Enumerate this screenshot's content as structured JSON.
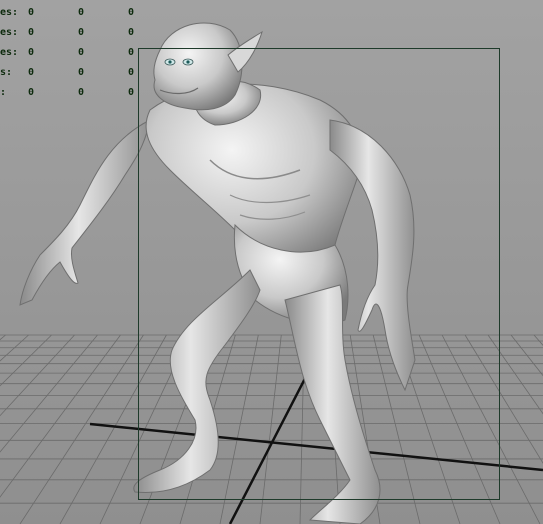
{
  "hud": {
    "rows": [
      {
        "label": "es:",
        "v1": "0",
        "v2": "0",
        "v3": "0"
      },
      {
        "label": "es:",
        "v1": "0",
        "v2": "0",
        "v3": "0"
      },
      {
        "label": "es:",
        "v1": "0",
        "v2": "0",
        "v3": "0"
      },
      {
        "label": "s:",
        "v1": "0",
        "v2": "0",
        "v3": "0"
      },
      {
        "label": ":",
        "v1": "0",
        "v2": "0",
        "v3": "0"
      }
    ]
  },
  "viewport": {
    "background_color": "#9a9a9a",
    "grid_color": "#6a6a6a",
    "axis_color": "#111111",
    "resolution_gate_color": "#1e3a2a",
    "model_color": "#c9c9c9"
  }
}
